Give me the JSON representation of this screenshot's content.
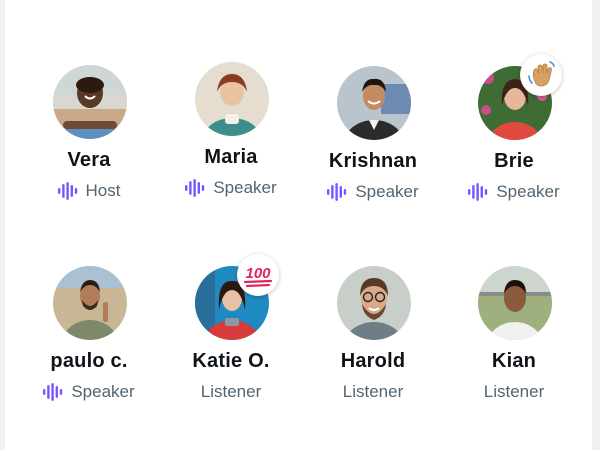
{
  "colors": {
    "accent": "#7856ff",
    "name_text": "#0f1419",
    "role_text": "#536471",
    "background": "#ffffff"
  },
  "participants": [
    {
      "name": "Vera",
      "role": "Host",
      "speaking_icon": "audio-waveform-icon"
    },
    {
      "name": "Maria",
      "role": "Speaker",
      "speaking_icon": "audio-waveform-icon"
    },
    {
      "name": "Krishnan",
      "role": "Speaker",
      "speaking_icon": "audio-waveform-icon"
    },
    {
      "name": "Brie",
      "role": "Speaker",
      "speaking_icon": "audio-waveform-icon",
      "reaction": "waving-hand-emoji"
    },
    {
      "name": "paulo c.",
      "role": "Speaker",
      "speaking_icon": "audio-waveform-icon"
    },
    {
      "name": "Katie O.",
      "role": "Listener",
      "reaction": "hundred-points-emoji",
      "reaction_text": "100"
    },
    {
      "name": "Harold",
      "role": "Listener"
    },
    {
      "name": "Kian",
      "role": "Listener"
    }
  ]
}
